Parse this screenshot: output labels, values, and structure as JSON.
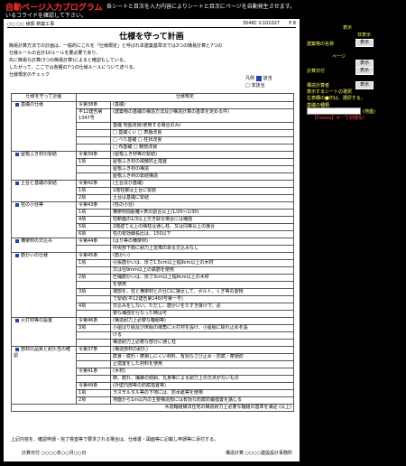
{
  "app": {
    "title": "自動ページ入力プログラム",
    "hint1": "各シートと目次を入力内容によりシートと目次にページを自動発生させます。",
    "hint2": "いるコライドを確認して下さい。"
  },
  "doc": {
    "hdr_left": "○○ ○○ 様邸 新築工事",
    "hdr_right": "P 8",
    "hdr_mid": "304KC V.101027",
    "title": "仕様を守って計画",
    "intro": [
      "簡易計算方法での計画は、一般的にこれを「仕様規定」と呼ばれ本建築基準法では3つの簡易計算と7つの",
      "仕様ルールの合計10ルールを要必要であり、",
      "先に簡易な計算(3つの簡易計算)によると確認もしている。",
      "したがって、ここでは各種の7つの仕様ルールについて述べる。"
    ],
    "check_label": "仕様規定のチェック",
    "legend": {
      "title": "凡例",
      "applied": "該当",
      "na": "□ 非該当"
    },
    "col_a": "仕様を守って計画",
    "col_b": "仕様規定",
    "rows": [
      {
        "name": "基礎の仕様",
        "items": [
          [
            "令第38条",
            "(基礎)"
          ],
          [
            "平12建告第1347号",
            "(建築物の基礎の構造方法及び構造計算の基準を定める件)"
          ],
          [
            "",
            "基礎     地盤改良(使用する場合のみ)"
          ],
          [
            "",
            "□ 基礎くい  □ 表層改良"
          ],
          [
            "",
            "□ べた基礎  □ 柱状改良"
          ],
          [
            "",
            "□ 布基礎   □ 鋼管改良"
          ]
        ]
      },
      {
        "name": "屋根ふき材の緊結",
        "items": [
          [
            "令第39条",
            "(屋根ふき材等の緊結)"
          ],
          [
            "1項",
            "屋根ふき材の飛散防止措置"
          ],
          [
            "",
            "屋根ふき材の構造"
          ],
          [
            "",
            "屋根ふき材の緊結構造"
          ]
        ]
      },
      {
        "name": "土台と基礎の緊結",
        "items": [
          [
            "令第42条",
            "(土台及び基礎)"
          ],
          [
            "1項",
            "1階柱脚は土台に緊結"
          ],
          [
            "2項",
            "土台は基礎に緊結"
          ]
        ]
      },
      {
        "name": "柱の小径等",
        "items": [
          [
            "令第43条",
            "(柱の小径)"
          ],
          [
            "1項",
            "横架材間距離×表の割合以上(1/20～1/30)"
          ],
          [
            "4項",
            "柱断面の1/3以上欠き取る場合には補強"
          ],
          [
            "5項",
            "2階建て以上の隅柱は通し柱、又は同等以上の接合"
          ],
          [
            "6項",
            "柱の有効細長比は、150以下"
          ]
        ]
      },
      {
        "name": "横架材の欠込み",
        "items": [
          [
            "令第44条",
            "(はり等の横架材)"
          ],
          [
            "",
            "中央部下側に耐力上支障のある欠込みなし"
          ]
        ]
      },
      {
        "name": "筋かいの仕様",
        "items": [
          [
            "令第45条",
            "(筋かい)"
          ],
          [
            "1項",
            "引張筋かいは、厚さ1.5cm以上幅9cm以上の木材"
          ],
          [
            "",
            "又は径9mm以上の鉄筋を使用"
          ],
          [
            "2項",
            "圧縮筋かいは、厚さ3cm以上幅9cm以上の木材"
          ],
          [
            "",
            "を使用"
          ],
          [
            "3項",
            "端部を、柱と横架材との仕口に接近して、ボルト、くぎ等の金物"
          ],
          [
            "",
            "で緊結(平12建告第1460号第一号)"
          ],
          [
            "4項",
            "欠込みをしない。ただし、筋かいをたすき掛けで、必"
          ],
          [
            "",
            "要な補強を行なった時は可"
          ]
        ]
      },
      {
        "name": "火打材等の設置",
        "items": [
          [
            "令第46条",
            "(構造耐力上必要な軸組等)"
          ],
          [
            "3項",
            "小屋ばり組及び床組の隅角に火打材を設け、小屋組に振れ止めを設"
          ],
          [
            "",
            "ける"
          ],
          [
            "",
            "構造耐力上必要な部分に通し柱"
          ]
        ]
      },
      {
        "name": "部材の品質と耐久性の確認",
        "items": [
          [
            "令第37条",
            "(構造部材の耐久)"
          ],
          [
            "",
            "腐食・腐朽・摩損しにくい材料、有効なさび止め・防腐・摩損防"
          ],
          [
            "",
            "止措置をした材料を使用"
          ],
          [
            "令第41条",
            "(木材)"
          ],
          [
            "",
            "節、腐れ、繊維の傾斜、丸身等による耐力上の欠点がないもの"
          ],
          [
            "令第49条",
            "(外壁内部等の防腐措置等)"
          ],
          [
            "1項",
            "ラスモルタル等の下地には、防水紙等を使用"
          ],
          [
            "2項",
            "地面から1m以内の主要構造部には有効な防腐防蟻措置を講じる"
          ]
        ]
      }
    ],
    "tail": "木造軸組構法住宅の構造耐力上必要な軸組の基準を満足 (以上)",
    "footer_note": "上記内容を、確認申請・完了検査等で要求される場合は、仕様書・図面等に記載し申請等に添付する。",
    "sig_left": "計算日付 ○○○○年○○月○○日",
    "sig_right": "構造計算 ○○○○建設設計事務所"
  },
  "side": {
    "l1": "表示",
    "l2": "非表示",
    "l3": "建築物の名称",
    "b1": "表示",
    "l4": "ページ",
    "b2": "表示",
    "l5": "計算日付",
    "b3": "表示",
    "l6": "構造計算者",
    "b4": "表示",
    "l7": "表示するシートの選択",
    "l8": "左表欄の■印は、選択する。",
    "l9": "基礎の種類",
    "l10": "(地盤)",
    "red": "【Delete】キーで初期化!"
  }
}
